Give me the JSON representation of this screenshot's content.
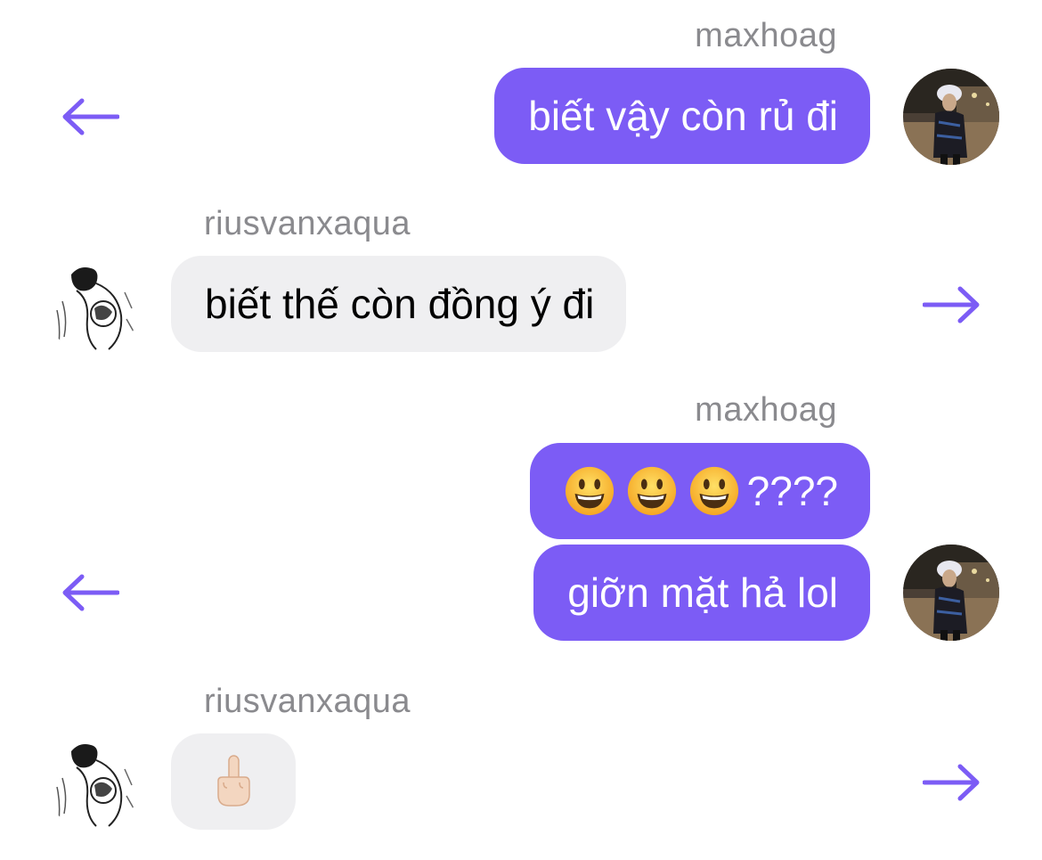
{
  "messages": [
    {
      "sender": "maxhoag",
      "text": "biết vậy còn rủ đi",
      "direction": "outgoing"
    },
    {
      "sender": "riusvanxaqua",
      "text": "biết thế còn đồng ý đi",
      "direction": "incoming"
    },
    {
      "sender": "maxhoag",
      "text": "????",
      "emoji_prefix": "grinning-face x3",
      "direction": "outgoing"
    },
    {
      "sender": "",
      "text": "giỡn mặt hả lol",
      "direction": "outgoing"
    },
    {
      "sender": "riusvanxaqua",
      "text": "",
      "emoji": "middle-finger",
      "direction": "incoming"
    }
  ],
  "icons": {
    "reply_left": "arrow-left-icon",
    "forward_right": "arrow-right-icon"
  },
  "colors": {
    "accent": "#7c5cf5",
    "incoming_bubble": "#efeff1",
    "sender_name": "#8a8a8e"
  }
}
